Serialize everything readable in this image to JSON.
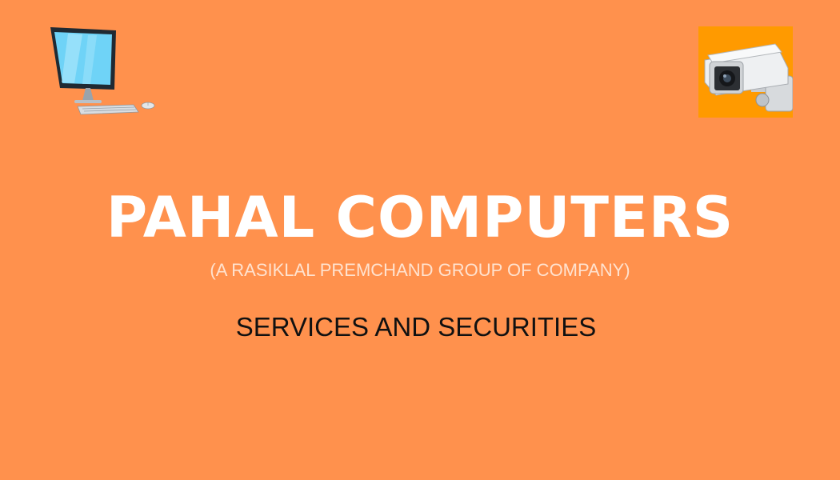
{
  "colors": {
    "background": "#FF914D",
    "title": "#FFFFFF",
    "subtitle": "#FFE2CF",
    "tagline": "#111111",
    "camera_tile": "#FF9A00"
  },
  "icons": {
    "left": "desktop-computer-icon",
    "right": "cctv-camera-icon"
  },
  "banner": {
    "title": "PAHAL COMPUTERS",
    "subtitle": "(A RASIKLAL PREMCHAND GROUP OF COMPANY)",
    "tagline": "SERVICES AND SECURITIES"
  }
}
